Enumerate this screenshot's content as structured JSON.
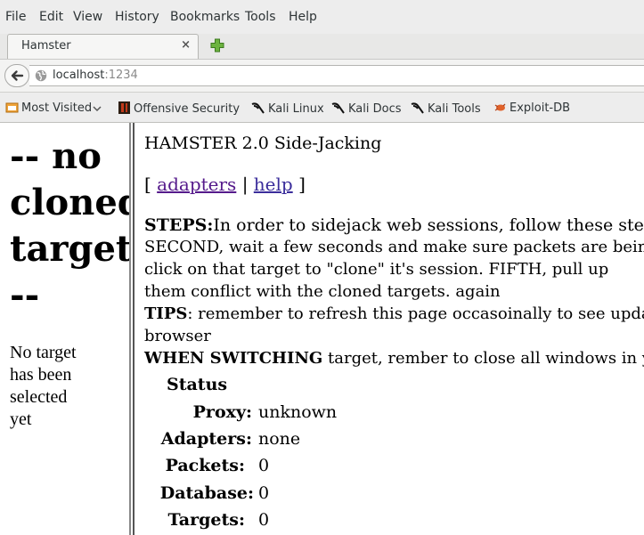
{
  "menu": {
    "items": [
      "File",
      "Edit",
      "View",
      "History",
      "Bookmarks",
      "Tools",
      "Help"
    ]
  },
  "tab": {
    "title": "Hamster",
    "close_glyph": "×"
  },
  "url": {
    "host": "localhost",
    "port": ":1234"
  },
  "bookmarks": {
    "items": [
      "Most Visited",
      "Offensive Security",
      "Kali Linux",
      "Kali Docs",
      "Kali Tools",
      "Exploit-DB"
    ]
  },
  "left_frame": {
    "heading_lines": [
      "-- no",
      "cloned",
      "target",
      "--"
    ],
    "message_lines": [
      "No target",
      "has been",
      "selected",
      "yet"
    ]
  },
  "right_frame": {
    "title": "HAMSTER 2.0 Side-Jacking",
    "bracket_open": "[",
    "adapters_link": "adapters",
    "separator": "|",
    "help_link": "help",
    "bracket_close": "]",
    "steps_label": "STEPS:",
    "steps_text_1": "In order to sidejack web sessions, follow these steps. FIRST,",
    "steps_text_2": "SECOND, wait a few seconds and make sure packets are being",
    "steps_text_3": "click on that target to \"clone\" it's session. FIFTH, pull up",
    "steps_text_4": "them conflict with the cloned targets. again",
    "tips_label": "TIPS",
    "tips_text_1": ": remember to refresh this page occasoinally to see updates,",
    "tips_text_2": "browser",
    "switch_label": "WHEN SWITCHING",
    "switch_text": " target, rember to close all windows in your",
    "status_heading": "Status",
    "status": [
      {
        "label": "Proxy:",
        "value": "unknown"
      },
      {
        "label": "Adapters:",
        "value": "none"
      },
      {
        "label": "Packets:",
        "value": "0"
      },
      {
        "label": "Database:",
        "value": "0"
      },
      {
        "label": "Targets:",
        "value": "0"
      }
    ]
  },
  "colors": {
    "link": "#3a2d9b",
    "visited_link": "#551a8b",
    "chrome_bg": "#ededed"
  }
}
